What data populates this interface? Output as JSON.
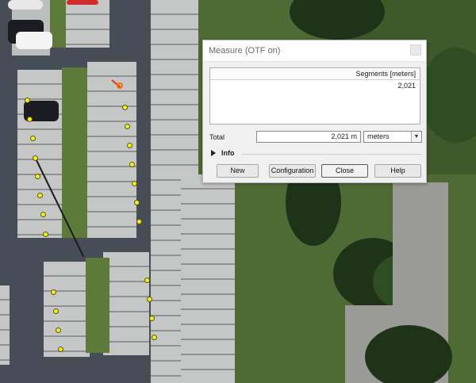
{
  "dialog": {
    "title": "Measure (OTF on)",
    "close_icon": "close-icon",
    "table": {
      "header": "Segments [meters]",
      "rows": [
        "2,021"
      ]
    },
    "total_label": "Total",
    "total_value": "2,021 m",
    "unit_select": {
      "selected": "meters"
    },
    "info": {
      "label": "Info",
      "icon": "triangle-right-icon"
    },
    "buttons": {
      "new": "New",
      "configuration": "Configuration",
      "close": "Close",
      "help": "Help"
    }
  },
  "map": {
    "measure_point_color": "#f3f020",
    "cursor_color": "#ff6a00"
  }
}
